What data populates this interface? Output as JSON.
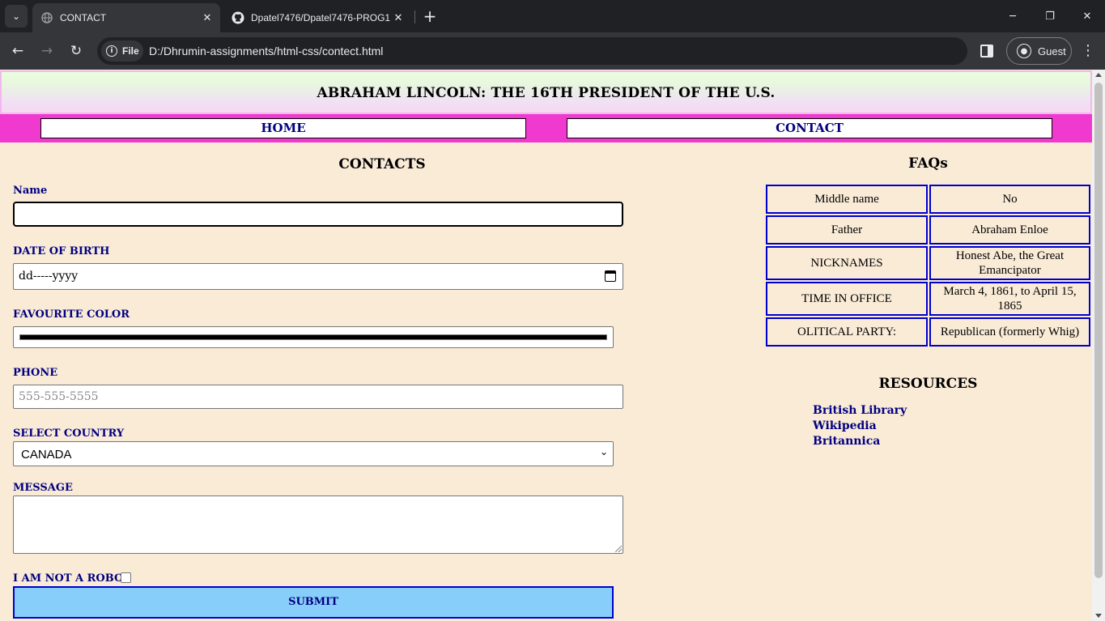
{
  "browser": {
    "tabs": [
      {
        "title": "CONTACT",
        "active": true
      },
      {
        "title": "Dpatel7476/Dpatel7476-PROG1",
        "active": false
      }
    ],
    "file_chip": "File",
    "url": "D:/Dhrumin-assignments/html-css/contect.html",
    "profile": "Guest"
  },
  "header": {
    "title": "ABRAHAM LINCOLN: THE 16TH PRESIDENT OF THE U.S."
  },
  "nav": {
    "home": "HOME",
    "contact": "CONTACT"
  },
  "form": {
    "title": "CONTACTS",
    "name_label": "Name",
    "name_value": "",
    "dob_label": "DATE OF BIRTH",
    "dob_value": "dd-----yyyy",
    "color_label": "FAVOURITE COLOR",
    "color_value": "#000000",
    "phone_label": "PHONE",
    "phone_placeholder": "555-555-5555",
    "country_label": "SELECT COUNTRY",
    "country_value": "CANADA",
    "message_label": "MESSAGE",
    "robot_label": "I AM NOT A ROBOT",
    "submit_label": "SUBMIT"
  },
  "faqs": {
    "title": "FAQs",
    "rows": [
      {
        "q": "Middle name",
        "a": "No"
      },
      {
        "q": "Father",
        "a": "Abraham Enloe"
      },
      {
        "q": "NICKNAMES",
        "a": "Honest Abe, the Great Emancipator"
      },
      {
        "q": "TIME IN OFFICE",
        "a": "March 4, 1861, to April 15, 1865"
      },
      {
        "q": "OLITICAL PARTY:",
        "a": "Republican (formerly Whig)"
      }
    ]
  },
  "resources": {
    "title": "RESOURCES",
    "links": [
      "British Library",
      "Wikipedia",
      "Britannica"
    ]
  },
  "colors": {
    "page_bg": "#faebd7",
    "nav_bg": "#f03acf",
    "link": "#000080",
    "border_blue": "#0000cd",
    "submit_bg": "#87cefa"
  }
}
